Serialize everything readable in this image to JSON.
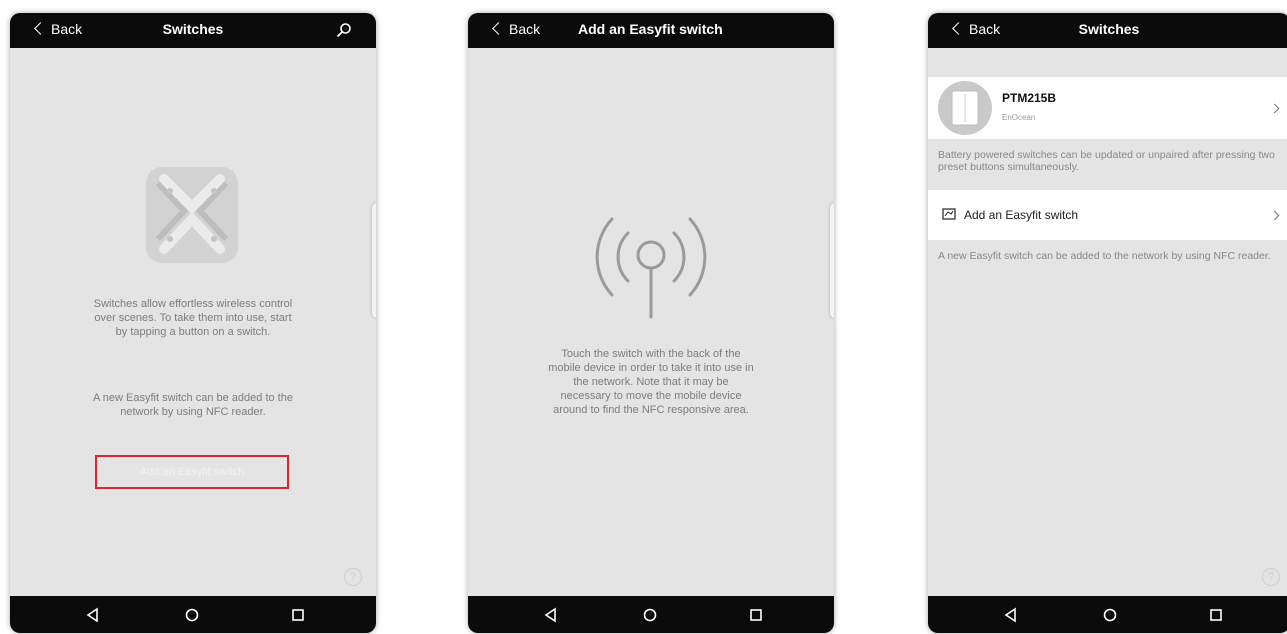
{
  "screen1": {
    "back_label": "Back",
    "title": "Switches",
    "icon": "search-icon",
    "description": "Switches allow effortless wireless control over scenes. To take them into use, start by tapping a button on a switch.",
    "nfc_note": "A new Easyfit switch can be added to the network by using NFC reader.",
    "add_button": "Add an Easyfit switch",
    "highlight_color": "#e0232e",
    "help_label": "?"
  },
  "screen2": {
    "back_label": "Back",
    "title": "Add an Easyfit switch",
    "icon": "nfc-antenna-icon",
    "instructions": "Touch the switch with the back of the mobile device in order to take it into use in the network. Note that it may be necessary to move the mobile device around to find the NFC responsive area."
  },
  "screen3": {
    "back_label": "Back",
    "title": "Switches",
    "device": {
      "name": "PTM215B",
      "vendor": "EnOcean"
    },
    "battery_note": "Battery powered switches can be updated or unpaired after pressing two preset buttons simultaneously.",
    "add_row_label": "Add an Easyfit switch",
    "nfc_note": "A new Easyfit switch can be added to the network by using NFC reader.",
    "help_label": "?"
  },
  "navbar": {
    "icons": [
      "back-triangle-icon",
      "home-circle-icon",
      "recents-square-icon"
    ]
  }
}
